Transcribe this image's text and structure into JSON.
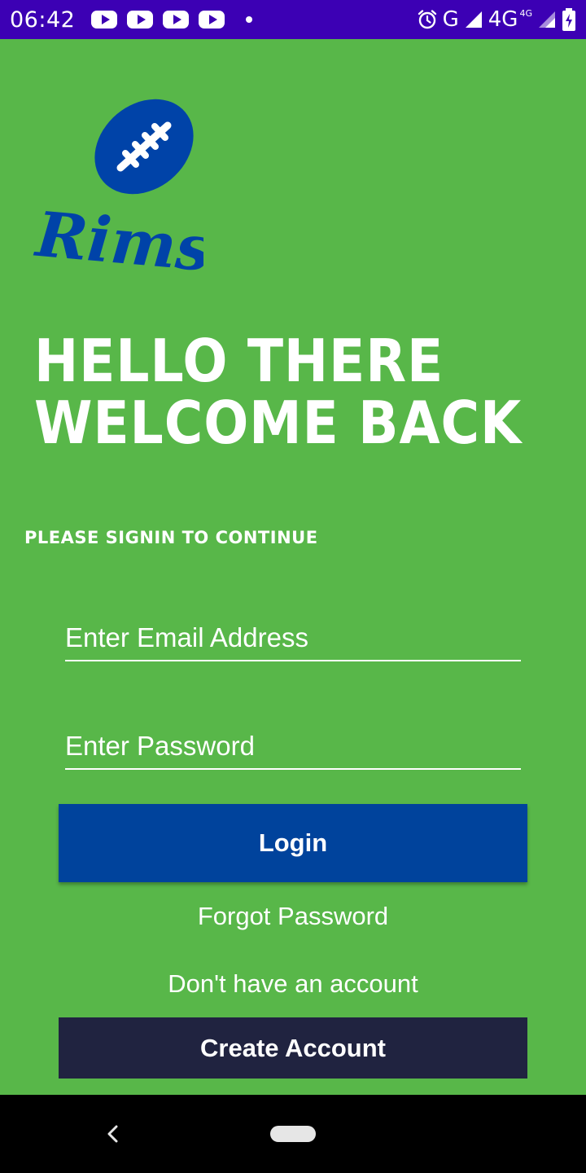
{
  "status_bar": {
    "time": "06:42",
    "network_label": "G",
    "network_4g": "4G",
    "network_4g_small": "4G",
    "notification_icons": [
      "youtube-icon",
      "youtube-icon",
      "youtube-icon",
      "youtube-icon",
      "dot-icon"
    ],
    "right_icons": [
      "alarm-icon",
      "signal-icon",
      "signal-icon",
      "battery-icon"
    ],
    "background_color": "#3c00b4"
  },
  "logo": {
    "text": "Rims",
    "icon": "football-icon",
    "ball_color": "#0043a8",
    "text_color": "#0043a8"
  },
  "login": {
    "headline_line1": "HELLO THERE",
    "headline_line2": "WELCOME BACK",
    "subtitle": "PLEASE SIGNIN TO CONTINUE",
    "email_placeholder": "Enter Email Address",
    "password_placeholder": "Enter Password",
    "login_button": "Login",
    "forgot_password": "Forgot Password",
    "no_account_text": "Don't have an account",
    "create_account_button": "Create Account"
  },
  "colors": {
    "background": "#58b749",
    "login_button": "#00439c",
    "create_button": "#202340",
    "text": "#ffffff"
  },
  "nav_bar": {
    "icons": [
      "back-icon",
      "home-pill-icon"
    ]
  }
}
